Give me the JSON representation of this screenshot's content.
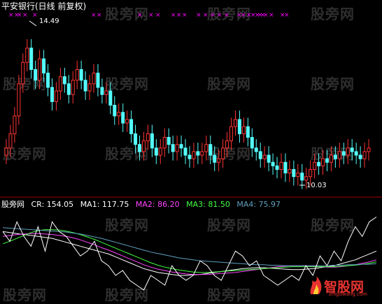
{
  "title": "平安银行(日线 前复权)",
  "watermark": "股旁网",
  "logo": {
    "text": "智股网",
    "sub": "zhiguwang.com"
  },
  "price": {
    "max_label": "14.49",
    "min_label": "10.03",
    "up_color": "#ff3333",
    "down_color": "#54ffff",
    "signal_color": "#ff00ff",
    "closes": [
      11.0,
      11.4,
      11.9,
      12.8,
      13.4,
      13.8,
      13.2,
      12.9,
      13.5,
      13.1,
      12.7,
      12.3,
      12.6,
      13.0,
      12.8,
      12.5,
      12.9,
      13.2,
      12.9,
      12.6,
      12.8,
      13.1,
      12.7,
      12.5,
      12.6,
      12.2,
      11.9,
      12.0,
      11.7,
      11.8,
      11.4,
      11.1,
      10.9,
      11.2,
      11.4,
      11.0,
      10.8,
      11.0,
      11.3,
      11.1,
      10.9,
      11.1,
      11.0,
      10.8,
      10.7,
      10.9,
      10.8,
      10.9,
      11.1,
      10.8,
      10.6,
      10.7,
      11.0,
      11.2,
      11.6,
      11.8,
      11.4,
      11.6,
      11.3,
      11.0,
      10.9,
      10.7,
      10.8,
      10.6,
      10.5,
      10.4,
      10.6,
      10.3,
      10.4,
      10.2,
      10.3,
      10.1,
      10.2,
      10.4,
      10.6,
      10.5,
      10.7,
      10.6,
      10.8,
      10.7,
      10.9,
      10.8,
      11.0,
      10.9,
      10.8,
      10.7,
      10.9,
      11.0
    ]
  },
  "indicator": {
    "name_label": "股旁网",
    "cr": {
      "label": "CR: 154.05",
      "color": "#ffffff"
    },
    "ma1": {
      "label": "MA1: 117.75",
      "color": "#ffffff"
    },
    "ma2": {
      "label": "MA2: 86.20",
      "color": "#ff44ff"
    },
    "ma3": {
      "label": "MA3: 81.50",
      "color": "#44ff44"
    },
    "ma4": {
      "label": "MA4: 75.97",
      "color": "#5f9fbf"
    },
    "cr_series": [
      130,
      110,
      150,
      120,
      100,
      140,
      90,
      150,
      130,
      120,
      100,
      80,
      90,
      110,
      70,
      60,
      40,
      50,
      30,
      20,
      10,
      40,
      30,
      20,
      60,
      40,
      30,
      40,
      70,
      60,
      40,
      30,
      60,
      90,
      80,
      60,
      70,
      40,
      30,
      20,
      30,
      40,
      30,
      60,
      40,
      80,
      60,
      90,
      70,
      110,
      140,
      120,
      150,
      160
    ],
    "ma_lines": [
      {
        "color": "#ffffff",
        "values": [
          130,
          128,
          126,
          124,
          122,
          120,
          118,
          116,
          112,
          108,
          104,
          100,
          96,
          92,
          88,
          84,
          78,
          72,
          66,
          60,
          54,
          50,
          46,
          44,
          42,
          40,
          40,
          41,
          42,
          44,
          46,
          48,
          50,
          52,
          54,
          55,
          56,
          56,
          55,
          54,
          53,
          52,
          52,
          53,
          54,
          56,
          58,
          60,
          64,
          68,
          72,
          78,
          84,
          90
        ]
      },
      {
        "color": "#ff44ff",
        "values": [
          120,
          122,
          124,
          125,
          126,
          126,
          125,
          124,
          122,
          120,
          117,
          113,
          108,
          103,
          97,
          92,
          86,
          80,
          74,
          68,
          62,
          57,
          53,
          50,
          47,
          45,
          43,
          42,
          42,
          42,
          43,
          44,
          45,
          46,
          48,
          50,
          52,
          54,
          56,
          58,
          59,
          60,
          60,
          60,
          59,
          58,
          57,
          57,
          58,
          60,
          62,
          65,
          68,
          72
        ]
      },
      {
        "color": "#44ff44",
        "values": [
          105,
          110,
          116,
          122,
          128,
          132,
          134,
          134,
          133,
          131,
          128,
          124,
          119,
          114,
          108,
          102,
          96,
          90,
          84,
          78,
          72,
          66,
          61,
          57,
          54,
          51,
          49,
          47,
          46,
          46,
          47,
          48,
          49,
          50,
          51,
          52,
          53,
          54,
          55,
          56,
          57,
          58,
          58,
          58,
          58,
          58,
          58,
          58,
          59,
          60,
          61,
          63,
          65,
          68
        ]
      },
      {
        "color": "#5f9fbf",
        "values": [
          138,
          137,
          136,
          135,
          134,
          133,
          132,
          131,
          130,
          129,
          127,
          125,
          122,
          119,
          116,
          112,
          108,
          104,
          100,
          96,
          92,
          88,
          85,
          82,
          79,
          76,
          74,
          72,
          70,
          69,
          68,
          67,
          66,
          65,
          64,
          63,
          62,
          62,
          61,
          61,
          60,
          60,
          60,
          60,
          60,
          60,
          60,
          61,
          61,
          62,
          62,
          63,
          63,
          64
        ]
      }
    ]
  }
}
